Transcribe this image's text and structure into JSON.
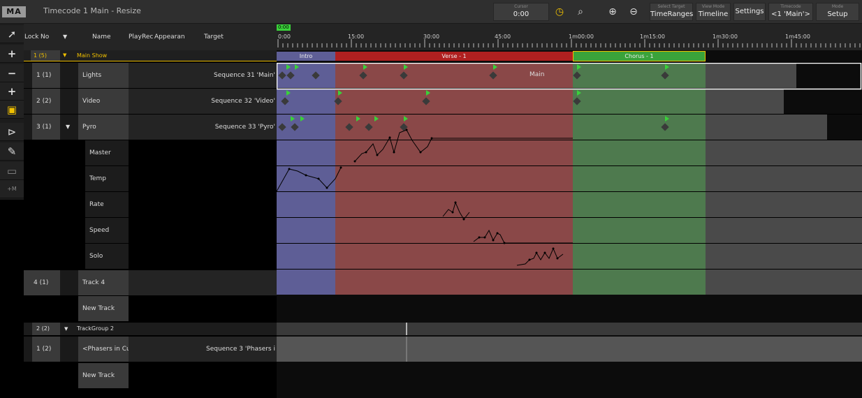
{
  "window": {
    "logo": "MA",
    "title": "Timecode 1 Main - Resize"
  },
  "toolbar": {
    "cursor_label": "Cursor",
    "cursor_value": "0:00",
    "select_target_label": "Select Target",
    "select_target_value": "TimeRanges",
    "view_mode_label": "View Mode",
    "view_mode_value": "Timeline",
    "settings": "Settings",
    "timecode_label": "Timecode",
    "timecode_value": "<1 'Main'>",
    "mode_label": "Mode",
    "mode_value": "Setup"
  },
  "columns": {
    "lock": "Lock",
    "no": "No",
    "name": "Name",
    "play": "Play",
    "rec": "Rec",
    "appearance": "Appearan",
    "target": "Target"
  },
  "ruler": {
    "current": "0:00",
    "ticks": [
      "0:00",
      "15:00",
      "30:00",
      "45:00",
      "1m00:00",
      "1m15:00",
      "1m30:00",
      "1m45:00"
    ]
  },
  "sections": [
    "Intro",
    "Verse - 1",
    "Chorus - 1"
  ],
  "rows": [
    {
      "no": "1 (5)",
      "name": "Main Show",
      "target": ""
    },
    {
      "no": "1 (1)",
      "name": "Lights",
      "target": "Sequence 31 'Main'"
    },
    {
      "no": "2 (2)",
      "name": "Video",
      "target": "Sequence 32 'Video'"
    },
    {
      "no": "3 (1)",
      "name": "Pyro",
      "target": "Sequence 33 'Pyro'"
    },
    {
      "no": "",
      "name": "Master",
      "target": ""
    },
    {
      "no": "",
      "name": "Temp",
      "target": ""
    },
    {
      "no": "",
      "name": "Rate",
      "target": ""
    },
    {
      "no": "",
      "name": "Speed",
      "target": ""
    },
    {
      "no": "",
      "name": "Solo",
      "target": ""
    },
    {
      "no": "4 (1)",
      "name": "Track 4",
      "target": ""
    },
    {
      "no": "",
      "name": "New Track",
      "target": ""
    },
    {
      "no": "2 (2)",
      "name": "TrackGroup 2",
      "target": ""
    },
    {
      "no": "1 (2)",
      "name": "<Phasers in Cu",
      "target": "Sequence 3 'Phasers i"
    },
    {
      "no": "",
      "name": "New Track",
      "target": ""
    }
  ],
  "lights_label": "Main",
  "left_tools_extra": "+M",
  "colors": {
    "intro": "#5e5e96",
    "verse": "#8a4848",
    "chorus": "#4e7a4e",
    "accent": "#f0c000"
  },
  "icons": [
    "arrow-select-icon",
    "plus-icon",
    "minus-icon",
    "plus-icon",
    "grid-select-icon",
    "play-cursor-icon",
    "pencil-icon",
    "eraser-icon",
    "stopwatch-icon",
    "zoom-icon",
    "zoom-in-icon",
    "zoom-out-icon"
  ]
}
